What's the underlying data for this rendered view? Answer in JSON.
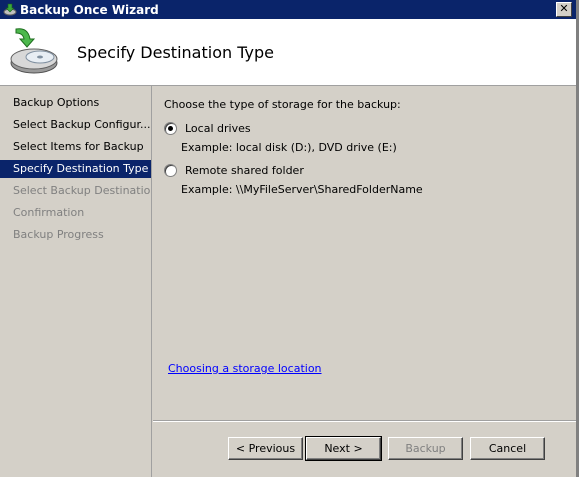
{
  "window": {
    "title": "Backup Once Wizard",
    "close_label": "✕"
  },
  "header": {
    "title": "Specify Destination Type"
  },
  "sidebar": {
    "items": [
      {
        "label": "Backup Options",
        "state": "done"
      },
      {
        "label": "Select Backup Configur...",
        "state": "done"
      },
      {
        "label": "Select Items for Backup",
        "state": "done"
      },
      {
        "label": "Specify Destination Type",
        "state": "selected"
      },
      {
        "label": "Select Backup Destination",
        "state": "disabled"
      },
      {
        "label": "Confirmation",
        "state": "disabled"
      },
      {
        "label": "Backup Progress",
        "state": "disabled"
      }
    ]
  },
  "main": {
    "prompt": "Choose the type of storage for the backup:",
    "options": [
      {
        "label": "Local drives",
        "example": "Example: local disk (D:), DVD drive (E:)",
        "checked": true
      },
      {
        "label": "Remote shared folder",
        "example": "Example: \\\\MyFileServer\\SharedFolderName",
        "checked": false
      }
    ],
    "link": "Choosing a storage location"
  },
  "buttons": {
    "previous": "< Previous",
    "next": "Next >",
    "backup": "Backup",
    "cancel": "Cancel"
  }
}
